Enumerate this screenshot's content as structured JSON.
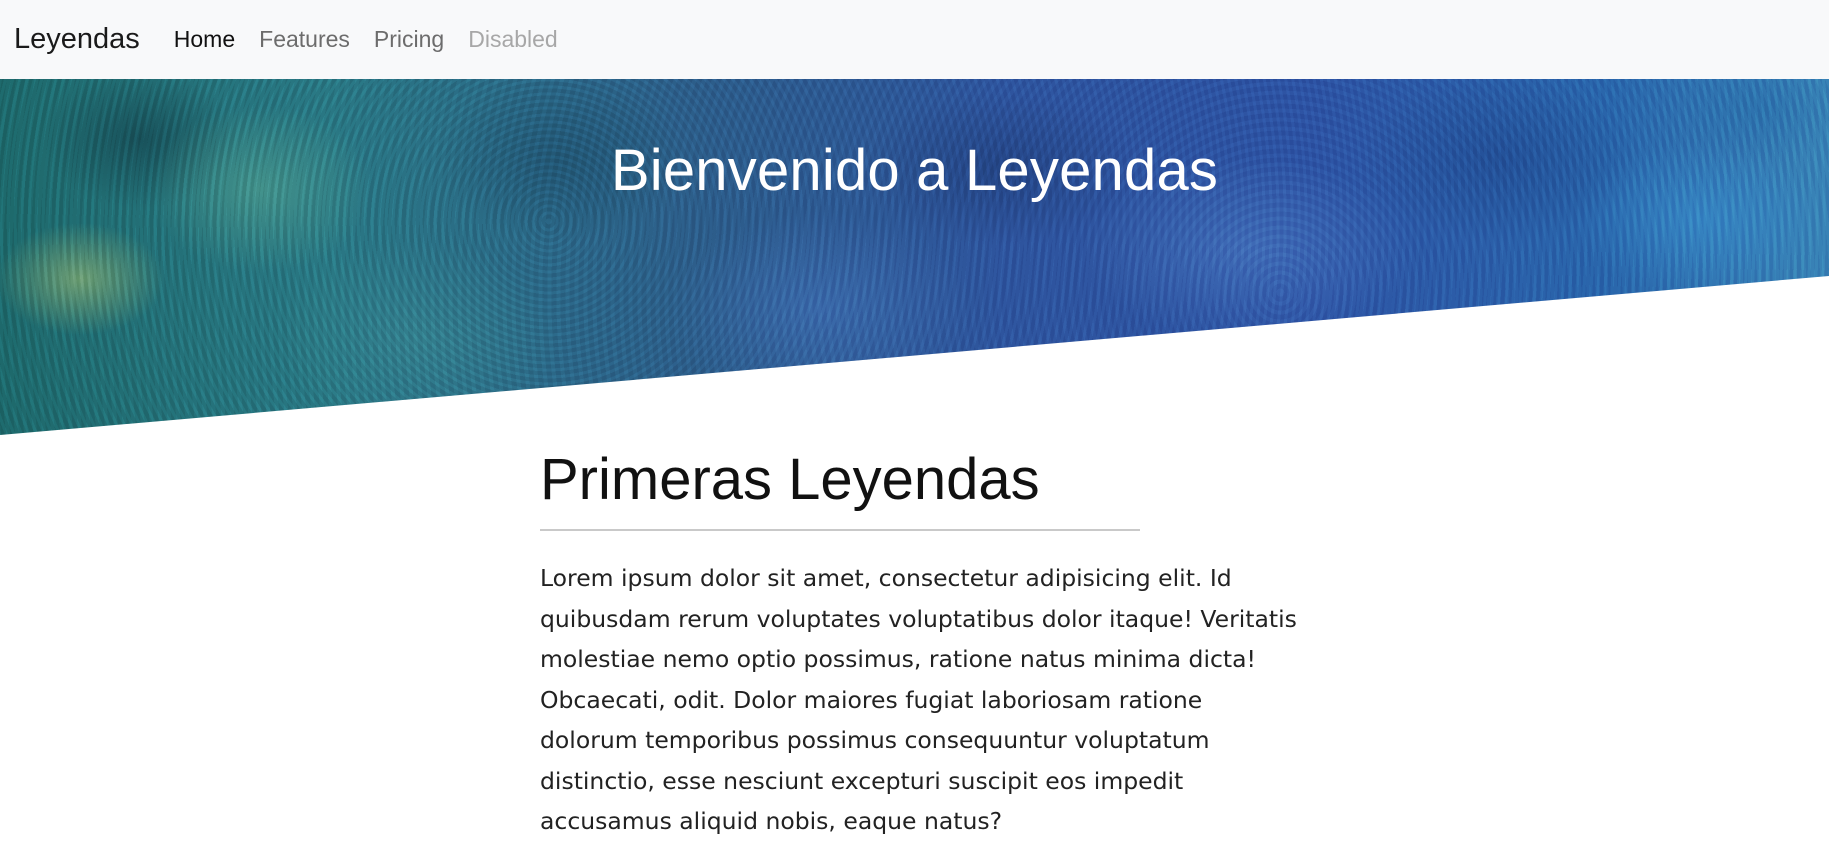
{
  "navbar": {
    "brand": "Leyendas",
    "links": [
      {
        "label": "Home",
        "state": "active"
      },
      {
        "label": "Features",
        "state": "normal"
      },
      {
        "label": "Pricing",
        "state": "normal"
      },
      {
        "label": "Disabled",
        "state": "disabled"
      }
    ]
  },
  "hero": {
    "title": "Bienvenido a Leyendas"
  },
  "section": {
    "title": "Primeras Leyendas",
    "paragraph": "Lorem ipsum dolor sit amet, consectetur adipisicing elit. Id quibusdam rerum voluptates voluptatibus dolor itaque! Veritatis molestiae nemo optio possimus, ratione natus minima dicta! Obcaecati, odit. Dolor maiores fugiat laboriosam ratione dolorum temporibus possimus consequuntur voluptatum distinctio, esse nesciunt excepturi suscipit eos impedit accusamus aliquid nobis, eaque natus?"
  },
  "colors": {
    "navbar_bg": "#f8f9fa",
    "brand_text": "#1a1a1a",
    "link_active": "#111111",
    "link_normal": "#6c6c6c",
    "link_disabled": "#a7a7a7",
    "hero_title": "#ffffff",
    "rule": "#c9c9c9"
  }
}
